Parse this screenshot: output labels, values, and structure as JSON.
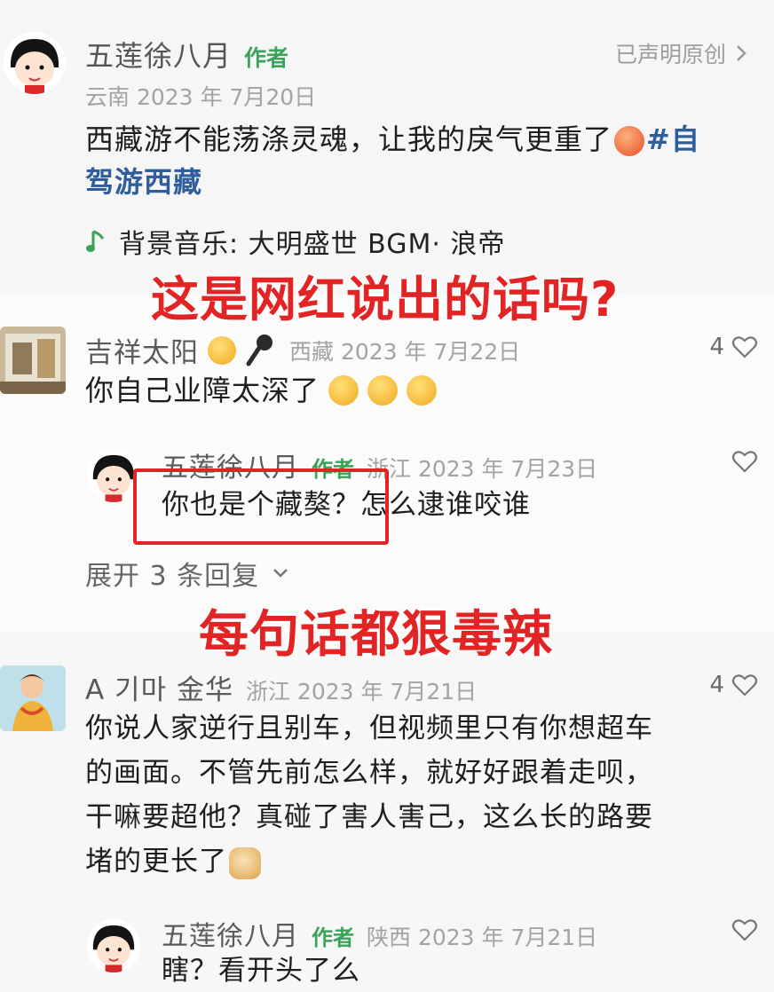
{
  "post": {
    "author": "五莲徐八月",
    "author_tag": "作者",
    "original_label": "已声明原创",
    "location_date": "云南 2023 年 7月20日",
    "text_line1": "西藏游不能荡涤灵魂，让我的戾气更重了",
    "hashtag_part1": "#自",
    "hashtag_part2": "驾游西藏",
    "music": "背景音乐: 大明盛世 BGM· 浪帝"
  },
  "overlays": {
    "top": "这是网红说出的话吗?",
    "middle": "每句话都狠毒辣"
  },
  "comments": [
    {
      "name": "吉祥太阳",
      "location_date": "西藏 2023 年 7月22日",
      "text": "你自己业障太深了",
      "likes": "4"
    },
    {
      "name": "A 기마 金华",
      "location_date": "浙江 2023 年 7月21日",
      "text_lines": [
        "你说人家逆行且别车，但视频里只有你想超车",
        "的画面。不管先前怎么样，就好好跟着走呗，",
        "干嘛要超他？真碰了害人害己，这么长的路要",
        "堵的更长了"
      ],
      "likes": "4"
    }
  ],
  "replies": [
    {
      "name": "五莲徐八月",
      "tag": "作者",
      "location_date": "浙江 2023 年 7月23日",
      "text_highlight": "你也是个藏獒？",
      "text_rest": "怎么逮谁咬谁"
    },
    {
      "name": "五莲徐八月",
      "tag": "作者",
      "location_date": "陕西 2023 年 7月21日",
      "text": "瞎？看开头了么"
    }
  ],
  "expand_replies": "展开 3 条回复",
  "icons": {
    "chevron": "chevron-right-icon",
    "heart": "heart-outline-icon",
    "music": "music-note-icon"
  },
  "colors": {
    "accent_green": "#3aa35a",
    "hashtag_blue": "#2f5d9e",
    "overlay_red": "#e22424",
    "highlight_box": "#e22424"
  }
}
